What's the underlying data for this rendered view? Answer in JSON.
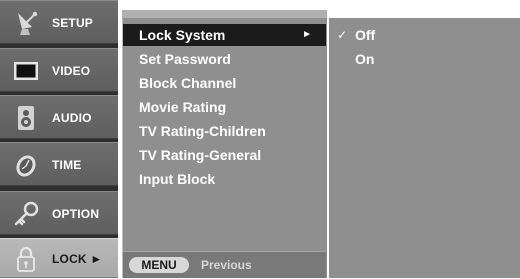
{
  "sidebar": {
    "items": [
      {
        "label": "SETUP",
        "icon": "satellite-dish-icon"
      },
      {
        "label": "VIDEO",
        "icon": "monitor-icon"
      },
      {
        "label": "AUDIO",
        "icon": "speaker-icon"
      },
      {
        "label": "TIME",
        "icon": "clock-icon"
      },
      {
        "label": "OPTION",
        "icon": "key-icon"
      },
      {
        "label": "LOCK ►",
        "icon": "padlock-icon",
        "active": true
      }
    ]
  },
  "submenu": {
    "items": [
      {
        "label": "Lock System",
        "selected": true,
        "has_arrow": true,
        "arrow": "►"
      },
      {
        "label": "Set Password"
      },
      {
        "label": "Block Channel"
      },
      {
        "label": "Movie Rating"
      },
      {
        "label": "TV Rating-Children"
      },
      {
        "label": "TV Rating-General"
      },
      {
        "label": "Input Block"
      }
    ],
    "footer": {
      "key_label": "MENU",
      "key_text": "Previous"
    }
  },
  "options": {
    "items": [
      {
        "label": "Off",
        "checked": true,
        "check_mark": "✓"
      },
      {
        "label": "On",
        "checked": false
      }
    ]
  },
  "colors": {
    "panel": "#8f8f8f",
    "selected_row": "#1b1b1b",
    "sidebar_item": "#5e5e5e",
    "sidebar_active": "#a9a9a9"
  }
}
